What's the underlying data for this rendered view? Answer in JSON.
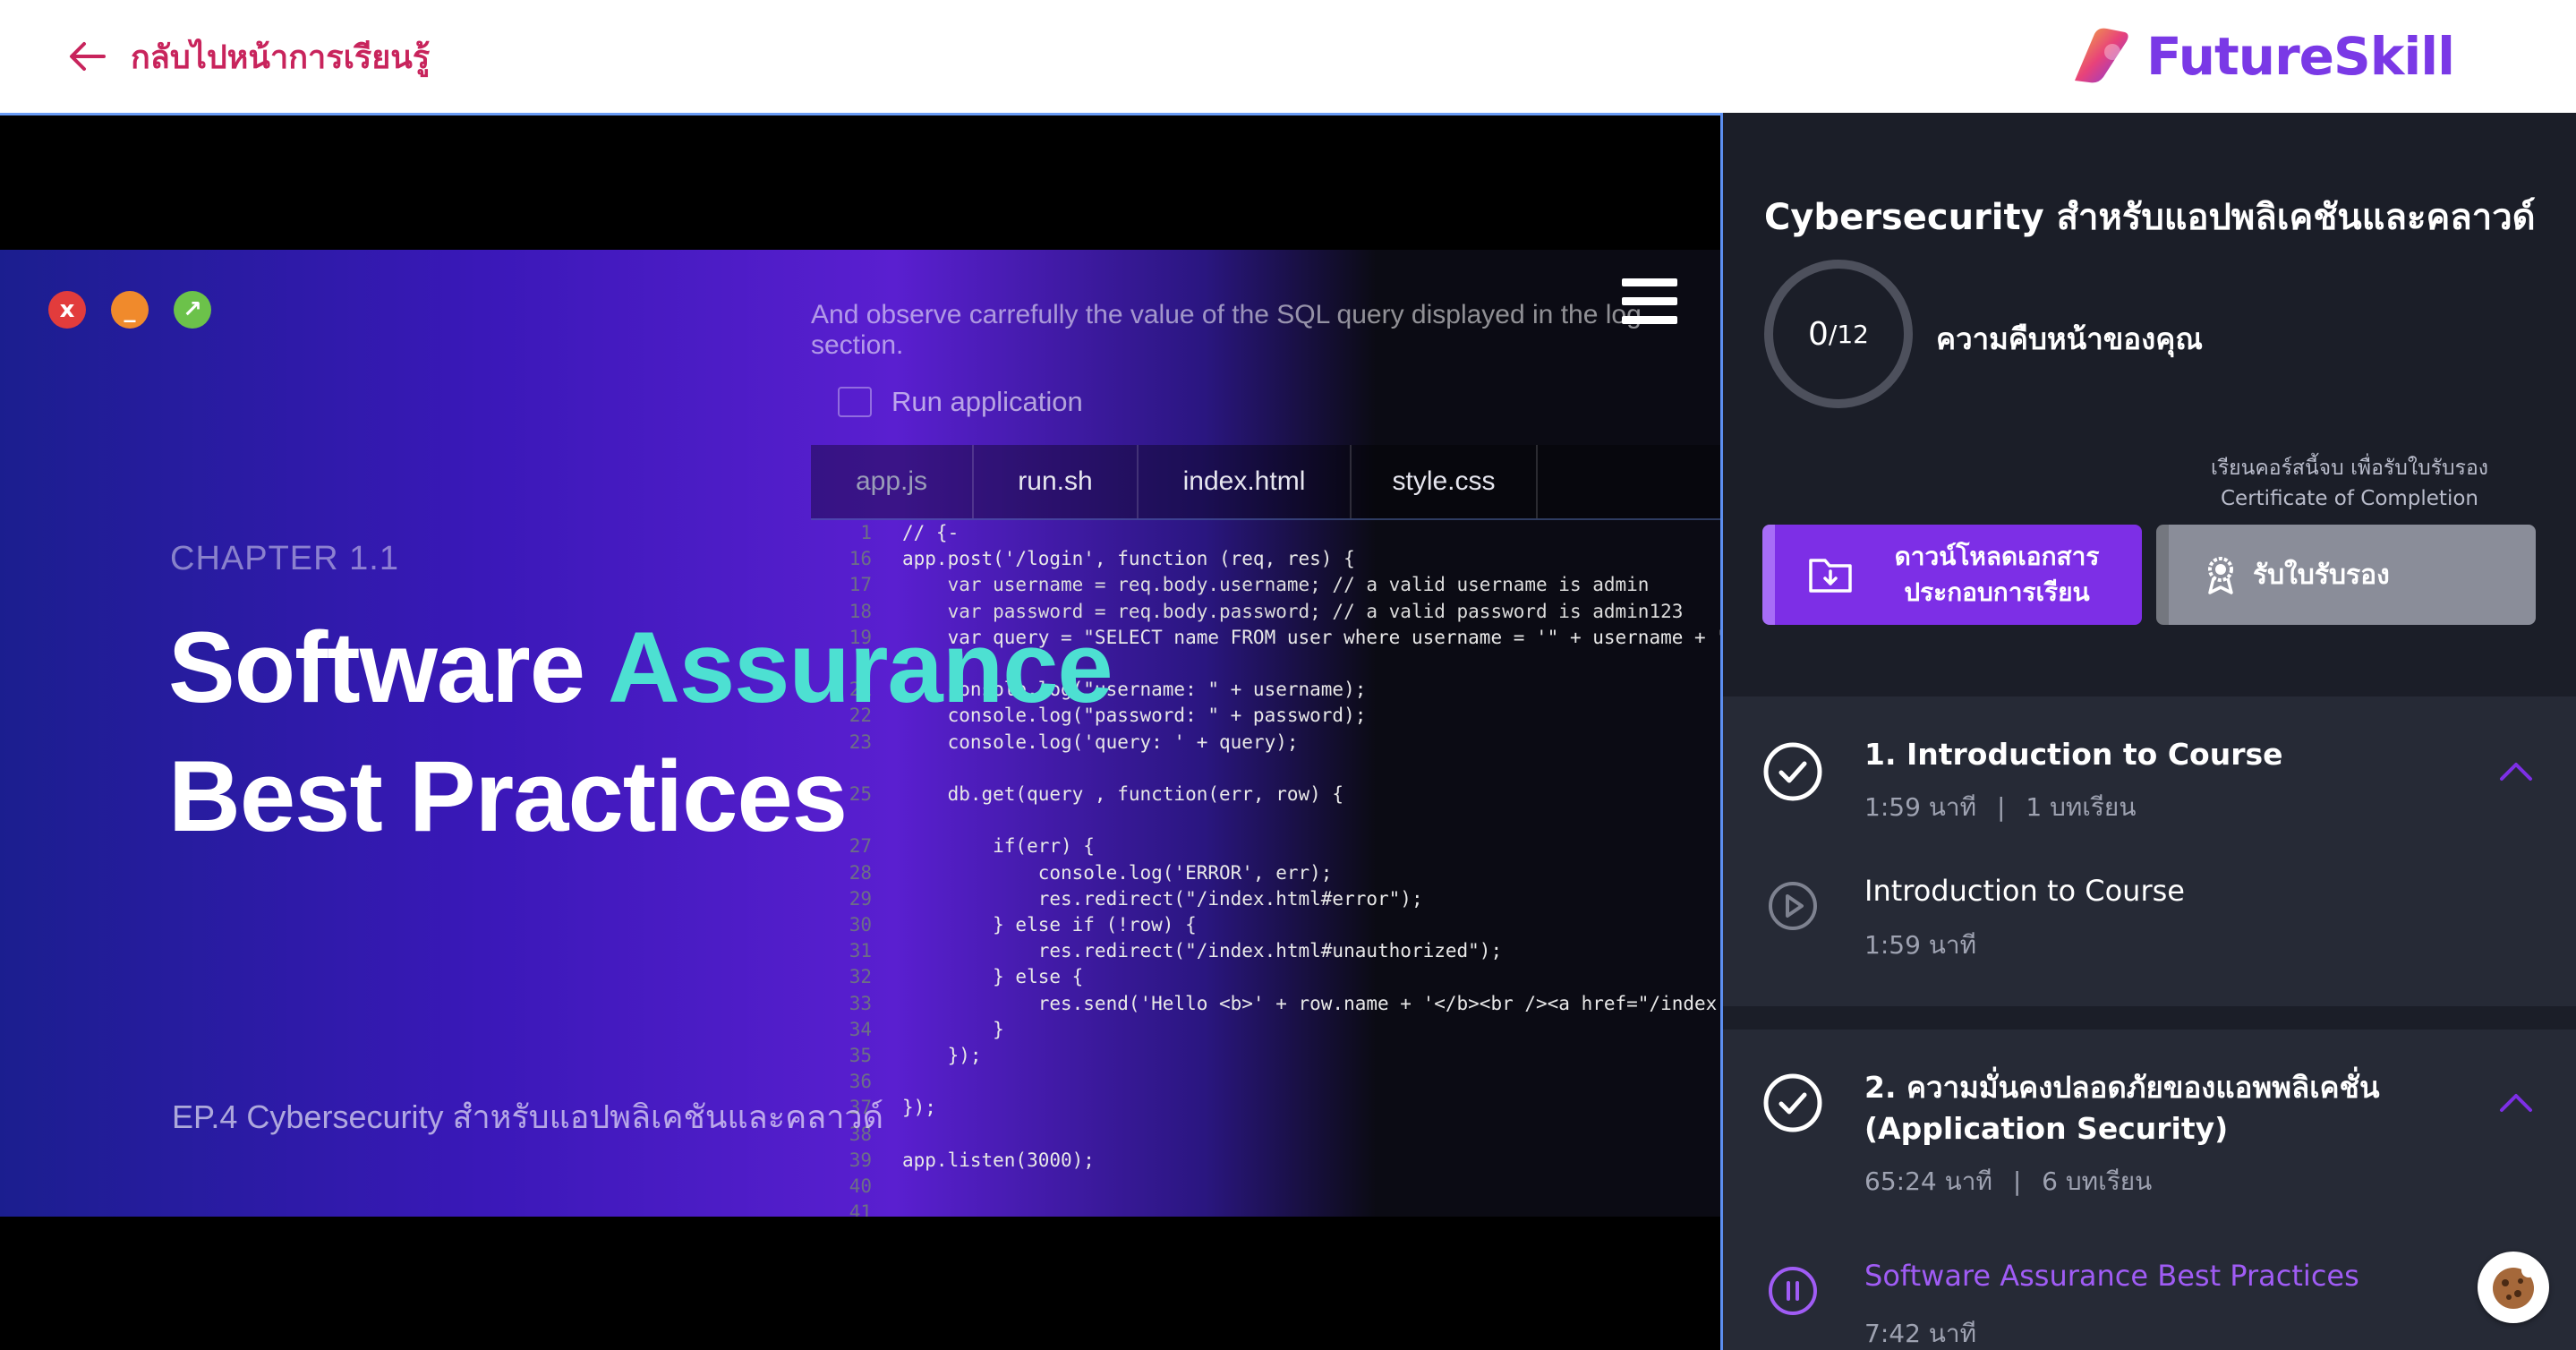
{
  "topbar": {
    "back_label": "กลับไปหน้าการเรียนรู้",
    "logo_text": "FutureSkill"
  },
  "video": {
    "observe_text": "And observe carrefully the value of the SQL query displayed in the log section.",
    "run_app": "Run application",
    "tabs": [
      "app.js",
      "run.sh",
      "index.html",
      "style.css"
    ],
    "chapter": "CHAPTER 1.1",
    "title_part1": "Software ",
    "title_accent": "Assurance",
    "title_line2": "Best Practices",
    "episode": "EP.4 Cybersecurity สำหรับแอปพลิเคชันและคลาวด์",
    "code_lines": [
      {
        "n": "1",
        "t": "// {-"
      },
      {
        "n": "16",
        "t": "app.post('/login', function (req, res) {"
      },
      {
        "n": "17",
        "t": "    var username = req.body.username; // a valid username is admin"
      },
      {
        "n": "18",
        "t": "    var password = req.body.password; // a valid password is admin123"
      },
      {
        "n": "19",
        "t": "    var query = \"SELECT name FROM user where username = '\" + username + \"' and"
      },
      {
        "n": "",
        "t": ""
      },
      {
        "n": "21",
        "t": "    console.log(\"username: \" + username);"
      },
      {
        "n": "22",
        "t": "    console.log(\"password: \" + password);"
      },
      {
        "n": "23",
        "t": "    console.log('query: ' + query);"
      },
      {
        "n": "",
        "t": ""
      },
      {
        "n": "25",
        "t": "    db.get(query , function(err, row) {"
      },
      {
        "n": "",
        "t": ""
      },
      {
        "n": "27",
        "t": "        if(err) {"
      },
      {
        "n": "28",
        "t": "            console.log('ERROR', err);"
      },
      {
        "n": "29",
        "t": "            res.redirect(\"/index.html#error\");"
      },
      {
        "n": "30",
        "t": "        } else if (!row) {"
      },
      {
        "n": "31",
        "t": "            res.redirect(\"/index.html#unauthorized\");"
      },
      {
        "n": "32",
        "t": "        } else {"
      },
      {
        "n": "33",
        "t": "            res.send('Hello <b>' + row.name + '</b><br /><a href=\"/index.html\""
      },
      {
        "n": "34",
        "t": "        }"
      },
      {
        "n": "35",
        "t": "    });"
      },
      {
        "n": "36",
        "t": ""
      },
      {
        "n": "37",
        "t": "});"
      },
      {
        "n": "38",
        "t": ""
      },
      {
        "n": "39",
        "t": "app.listen(3000);"
      },
      {
        "n": "40",
        "t": ""
      },
      {
        "n": "41",
        "t": ""
      }
    ]
  },
  "sidebar": {
    "course_title": "Cybersecurity สำหรับแอปพลิเคชันและคลาวด์",
    "progress_done": "0",
    "progress_total": "12",
    "progress_fraction": 0,
    "progress_label": "ความคืบหน้าของคุณ",
    "cert_note_line1": "เรียนคอร์สนี้จบ เพื่อรับใบรับรอง",
    "cert_note_line2": "Certificate of Completion",
    "download_label": "ดาวน์โหลดเอกสาร ประกอบการเรียน",
    "cert_button": "รับใบรับรอง",
    "sections": [
      {
        "title": "1. Introduction to Course",
        "duration": "1:59 นาที",
        "lessons_count": "1 บทเรียน",
        "lessons": [
          {
            "title": "Introduction to Course",
            "duration": "1:59 นาที",
            "state": "play"
          }
        ]
      },
      {
        "title_line1": "2. ความมั่นคงปลอดภัยของแอพพลิเคชั่น",
        "title_line2": "(Application Security)",
        "duration": "65:24 นาที",
        "lessons_count": "6 บทเรียน",
        "lessons": [
          {
            "title": "Software Assurance Best Practices",
            "duration": "7:42 นาที",
            "state": "playing"
          }
        ]
      }
    ]
  },
  "colors": {
    "accent_purple": "#7d2fe6",
    "back_link": "#c8245c",
    "title_accent": "#4de0d2",
    "active_lesson": "#a05cf5"
  }
}
